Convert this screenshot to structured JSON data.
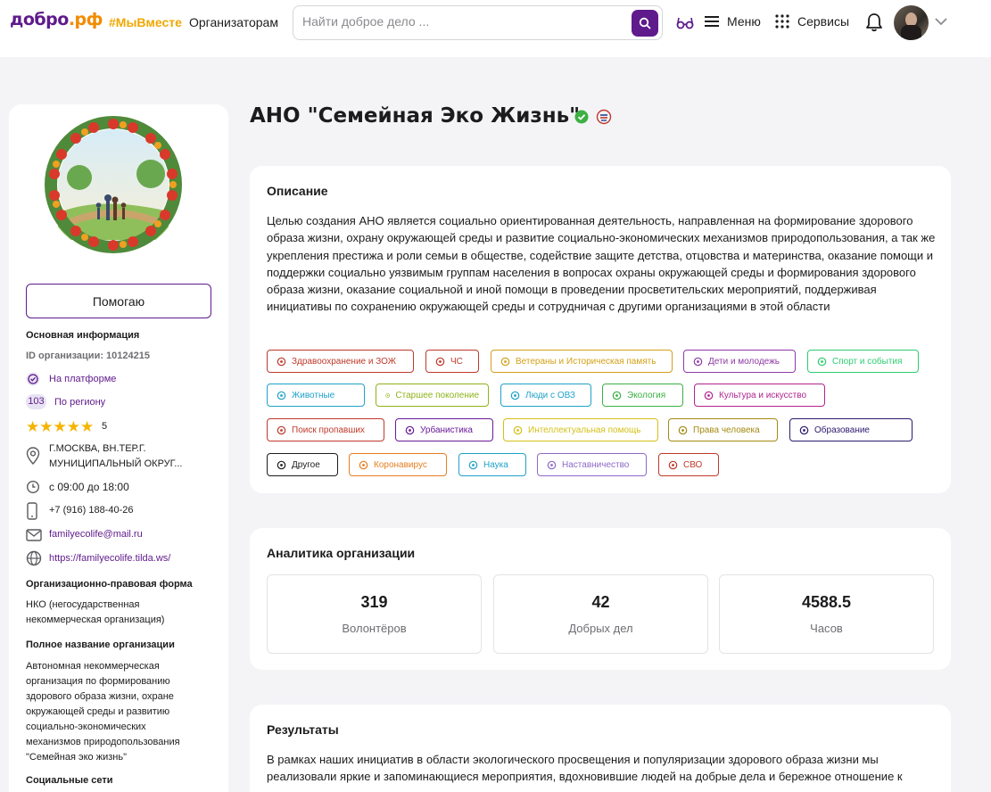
{
  "header": {
    "logo_text": "добро",
    "logo_suffix": ".рф",
    "hashtag": "#МыВместе",
    "organizers_link": "Организаторам",
    "search_placeholder": "Найти доброе дело ...",
    "menu_label": "Меню",
    "services_label": "Сервисы"
  },
  "sidebar": {
    "help_button": "Помогаю",
    "main_info_title": "Основная информация",
    "org_id": "ID организации: 10124215",
    "on_platform": "На платформе",
    "region_rank": "103",
    "by_region": "По региону",
    "rating_value": "5",
    "rating_stars": 5,
    "address_line1": "Г.МОСКВА, ВН.ТЕР.Г.",
    "address_line2": "МУНИЦИПАЛЬНЫЙ ОКРУГ...",
    "hours": "с 09:00 до 18:00",
    "phone": "+7 (916) 188-40-26",
    "email": "familyecolife@mail.ru",
    "website": "https://familyecolife.tilda.ws/",
    "legal_form_title": "Организационно-правовая форма",
    "legal_form_line1": "НКО (негосударственная",
    "legal_form_line2": "некоммерческая организация)",
    "full_name_title": "Полное название организации",
    "full_name_lines": [
      "Автономная некоммерческая",
      "организация по формированию",
      "здорового образа жизни, охране",
      "окружающей среды и развитию",
      "социально-экономических",
      "механизмов природопользования",
      "\"Семейная эко жизнь\""
    ],
    "social_title": "Социальные сети"
  },
  "page": {
    "title": "АНО \"Семейная Эко Жизнь\""
  },
  "description": {
    "title": "Описание",
    "text": "Целью создания АНО является социально ориентированная деятельность, направленная на формирование здорового образа жизни, охрану окружающей среды и развитие социально-экономических механизмов природопользования, а так же укрепления престижа и роли семьи в обществе, содействие защите детства, отцовства и материнства, оказание помощи и поддержки социально уязвимым группам населения в вопросах охраны окружающей среды и формирования здорового образа жизни, оказание социальной и иной помощи в проведении просветительских мероприятий, поддерживая инициативы по сохранению окружающей среды и сотрудничая с другими организациями в этой области"
  },
  "tags": [
    {
      "label": "Здравоохранение и ЗОЖ",
      "color": "#c0392b",
      "icon": "heart-pulse-icon"
    },
    {
      "label": "ЧС",
      "color": "#c0392b",
      "icon": "siren-icon"
    },
    {
      "label": "Ветераны и Историческая память",
      "color": "#d4a017",
      "icon": "medal-icon"
    },
    {
      "label": "Дети и молодежь",
      "color": "#8e3aa5",
      "icon": "family-icon"
    },
    {
      "label": "Спорт и события",
      "color": "#2ecc71",
      "icon": "runner-icon"
    },
    {
      "label": "Животные",
      "color": "#1fa2c8",
      "icon": "paw-icon"
    },
    {
      "label": "Старшее поколение",
      "color": "#8fb31a",
      "icon": "elder-icon"
    },
    {
      "label": "Люди с ОВЗ",
      "color": "#1fa2c8",
      "icon": "wheelchair-icon"
    },
    {
      "label": "Экология",
      "color": "#3cb043",
      "icon": "leaf-icon"
    },
    {
      "label": "Культура и искусство",
      "color": "#b0248f",
      "icon": "palette-icon"
    },
    {
      "label": "Поиск пропавших",
      "color": "#c0392b",
      "icon": "search-icon"
    },
    {
      "label": "Урбанистика",
      "color": "#6a1b9a",
      "icon": "building-icon"
    },
    {
      "label": "Интеллектуальная помощь",
      "color": "#d4c017",
      "icon": "bulb-icon"
    },
    {
      "label": "Права человека",
      "color": "#a38a12",
      "icon": "scales-icon"
    },
    {
      "label": "Образование",
      "color": "#2c1a6e",
      "icon": "graduation-cap-icon"
    },
    {
      "label": "Другое",
      "color": "#1c1c1e",
      "icon": "grid-icon"
    },
    {
      "label": "Коронавирус",
      "color": "#e67e22",
      "icon": "virus-icon"
    },
    {
      "label": "Наука",
      "color": "#1fa2c8",
      "icon": "atom-icon"
    },
    {
      "label": "Наставничество",
      "color": "#8e6ac8",
      "icon": "id-card-icon"
    },
    {
      "label": "СВО",
      "color": "#c0392b",
      "icon": "heart-hands-icon"
    }
  ],
  "analytics": {
    "title": "Аналитика организации",
    "stats": [
      {
        "value": "319",
        "label": "Волонтёров"
      },
      {
        "value": "42",
        "label": "Добрых дел"
      },
      {
        "value": "4588.5",
        "label": "Часов"
      }
    ]
  },
  "results": {
    "title": "Результаты",
    "text": "В рамках наших инициатив в области экологического просвещения и популяризации здорового образа жизни мы реализовали яркие и запоминающиеся мероприятия, вдохновившие людей на добрые дела и бережное отношение к"
  },
  "colors": {
    "brand_purple": "#5f1a8c",
    "brand_orange": "#f28b00",
    "hashtag_yellow": "#f0a800",
    "star": "#f5b400",
    "verified_green": "#3cb043"
  }
}
